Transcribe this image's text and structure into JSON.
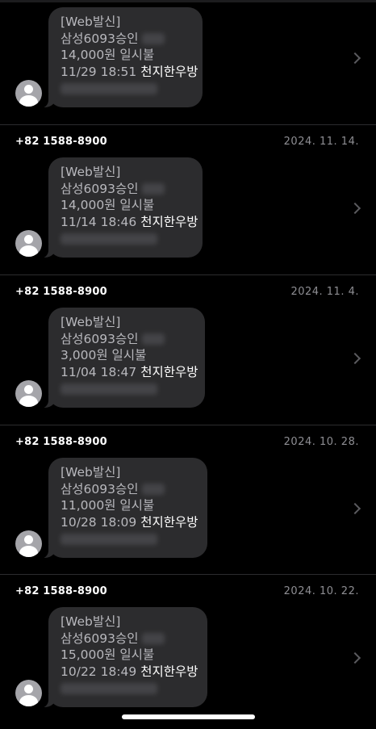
{
  "messages": [
    {
      "sender": "",
      "date": "",
      "prefix": "[Web발신]",
      "card": "삼성6093승인",
      "amount": "14,000원 일시불",
      "datetime": "11/29 18:51",
      "merchant": "천지한우방"
    },
    {
      "sender": "+82 1588-8900",
      "date": "2024. 11. 14.",
      "prefix": "[Web발신]",
      "card": "삼성6093승인",
      "amount": "14,000원 일시불",
      "datetime": "11/14 18:46",
      "merchant": "천지한우방"
    },
    {
      "sender": "+82 1588-8900",
      "date": "2024. 11. 4.",
      "prefix": "[Web발신]",
      "card": "삼성6093승인",
      "amount": "3,000원 일시불",
      "datetime": "11/04 18:47",
      "merchant": "천지한우방"
    },
    {
      "sender": "+82 1588-8900",
      "date": "2024. 10. 28.",
      "prefix": "[Web발신]",
      "card": "삼성6093승인",
      "amount": "11,000원 일시불",
      "datetime": "10/28 18:09",
      "merchant": "천지한우방"
    },
    {
      "sender": "+82 1588-8900",
      "date": "2024. 10. 22.",
      "prefix": "[Web발신]",
      "card": "삼성6093승인",
      "amount": "15,000원 일시불",
      "datetime": "10/22 18:49",
      "merchant": "천지한우방"
    }
  ],
  "icons": {
    "avatar": "person-icon",
    "chevron": "chevron-right-icon"
  }
}
